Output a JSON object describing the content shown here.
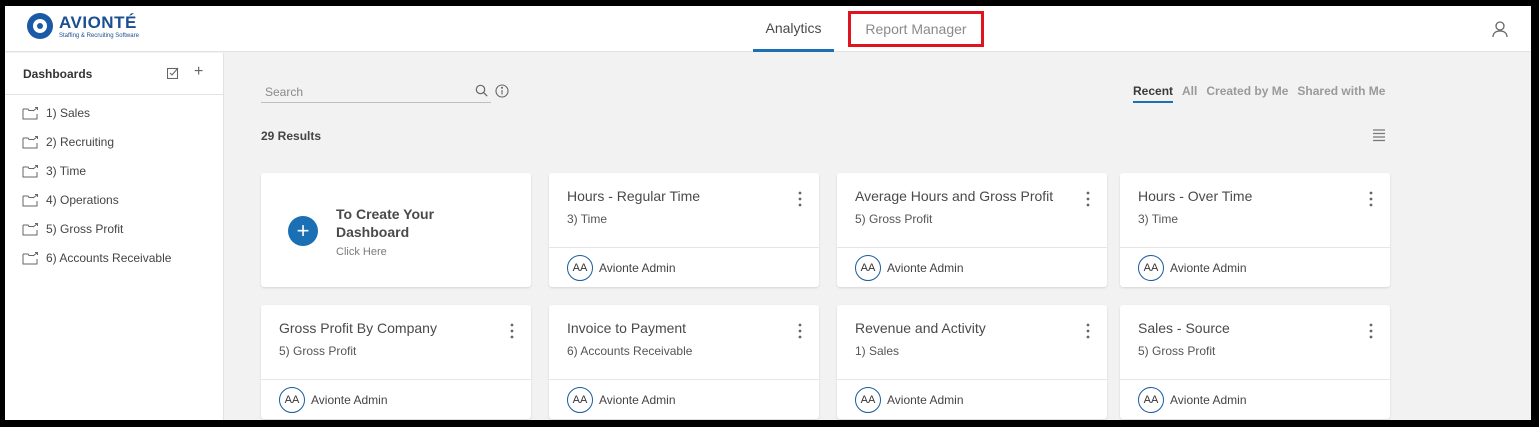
{
  "brand": {
    "name": "AVIONTÉ",
    "tagline": "Staffing & Recruiting Software"
  },
  "nav": {
    "tabs": [
      {
        "label": "Analytics",
        "active": true
      },
      {
        "label": "Report Manager",
        "highlighted": true
      }
    ],
    "user_icon": "user-icon"
  },
  "sidebar": {
    "title": "Dashboards",
    "items": [
      {
        "label": "1) Sales"
      },
      {
        "label": "2) Recruiting"
      },
      {
        "label": "3) Time"
      },
      {
        "label": "4) Operations"
      },
      {
        "label": "5) Gross Profit"
      },
      {
        "label": "6) Accounts Receivable"
      }
    ]
  },
  "search": {
    "placeholder": "Search",
    "value": ""
  },
  "filters": [
    "Recent",
    "All",
    "Created by Me",
    "Shared with Me"
  ],
  "active_filter": "Recent",
  "results_text": "29 Results",
  "create_card": {
    "title": "To Create Your Dashboard",
    "subtitle": "Click Here"
  },
  "cards": [
    {
      "title": "Hours - Regular Time",
      "category": "3) Time",
      "initials": "AA",
      "owner": "Avionte Admin"
    },
    {
      "title": "Average Hours and Gross Profit",
      "category": "5) Gross Profit",
      "initials": "AA",
      "owner": "Avionte Admin"
    },
    {
      "title": "Hours - Over Time",
      "category": "3) Time",
      "initials": "AA",
      "owner": "Avionte Admin"
    },
    {
      "title": "Gross Profit By Company",
      "category": "5) Gross Profit",
      "initials": "AA",
      "owner": "Avionte Admin"
    },
    {
      "title": "Invoice to Payment",
      "category": "6) Accounts Receivable",
      "initials": "AA",
      "owner": "Avionte Admin"
    },
    {
      "title": "Revenue and Activity",
      "category": "1) Sales",
      "initials": "AA",
      "owner": "Avionte Admin"
    },
    {
      "title": "Sales - Source",
      "category": "5) Gross Profit",
      "initials": "AA",
      "owner": "Avionte Admin"
    }
  ],
  "colors": {
    "accent": "#1a6fb5",
    "brand": "#1a4f91",
    "highlight": "#e0141f"
  }
}
